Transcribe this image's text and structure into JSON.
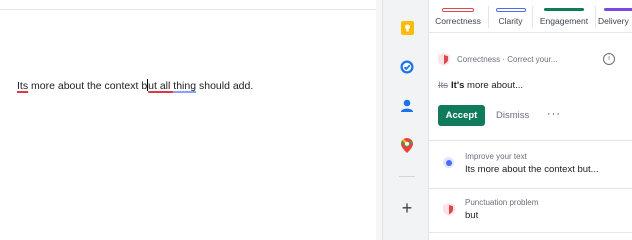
{
  "document": {
    "segments": [
      "Its",
      " more about the context b",
      "ut all ",
      "thing",
      " should add."
    ]
  },
  "sidebar": {
    "icons": [
      "keep-icon",
      "tasks-icon",
      "contacts-icon",
      "maps-icon",
      "add-icon"
    ]
  },
  "panel": {
    "tabs": [
      {
        "label": "Correctness",
        "color": "#e0474c"
      },
      {
        "label": "Clarity",
        "color": "#4a6cf7"
      },
      {
        "label": "Engagement",
        "color": "#0f7a5c"
      },
      {
        "label": "Delivery",
        "color": "#7a4ae0"
      }
    ],
    "card1": {
      "header": "Correctness · Correct your...",
      "original": "Its",
      "replacement": "It's",
      "rest": " more about...",
      "accept_label": "Accept",
      "dismiss_label": "Dismiss",
      "more_label": "···"
    },
    "card2": {
      "header": "Improve your text",
      "text": "Its more about the context but..."
    },
    "card3": {
      "header": "Punctuation problem",
      "text": "but"
    }
  },
  "colors": {
    "accept": "#0f7a5c",
    "error_underline": "#d93a4a",
    "clarity_underline": "#8aa2ff"
  }
}
